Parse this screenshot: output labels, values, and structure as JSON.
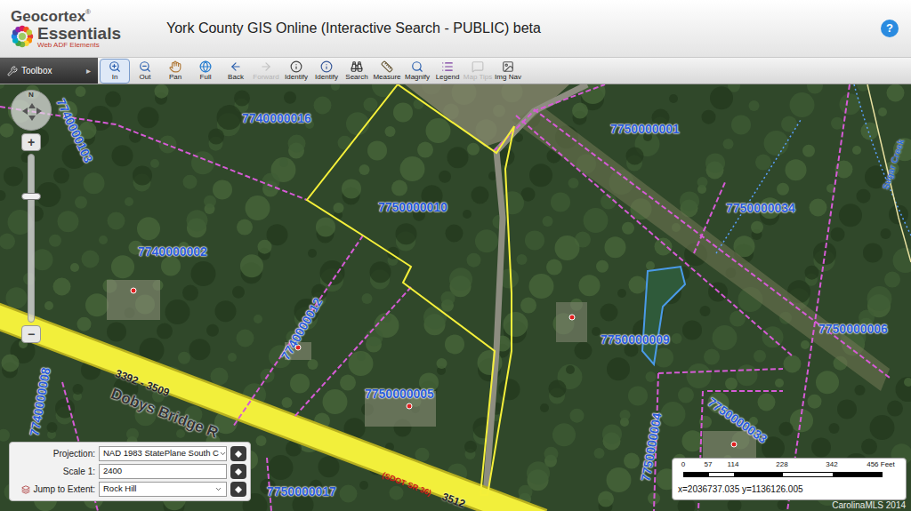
{
  "header": {
    "logo_name": "Geocortex",
    "logo_mark": "®",
    "logo_product": "Essentials",
    "logo_tagline": "Web ADF Elements",
    "title": "York County GIS Online (Interactive Search - PUBLIC) beta",
    "help": "?"
  },
  "toolbar": {
    "toolbox": "Toolbox",
    "toolbox_arrow": "▸",
    "tools": [
      {
        "label": "In",
        "selected": true,
        "disabled": false
      },
      {
        "label": "Out",
        "selected": false,
        "disabled": false
      },
      {
        "label": "Pan",
        "selected": false,
        "disabled": false
      },
      {
        "label": "Full",
        "selected": false,
        "disabled": false
      },
      {
        "label": "Back",
        "selected": false,
        "disabled": false
      },
      {
        "label": "Forward",
        "selected": false,
        "disabled": true
      },
      {
        "label": "Identify",
        "selected": false,
        "disabled": false
      },
      {
        "label": "Identify",
        "selected": false,
        "disabled": false
      },
      {
        "label": "Search",
        "selected": false,
        "disabled": false
      },
      {
        "label": "Measure",
        "selected": false,
        "disabled": false
      },
      {
        "label": "Magnify",
        "selected": false,
        "disabled": false
      },
      {
        "label": "Legend",
        "selected": false,
        "disabled": false
      },
      {
        "label": "Map Tips",
        "selected": false,
        "disabled": true
      },
      {
        "label": "Img Nav",
        "selected": false,
        "disabled": false
      }
    ]
  },
  "zoom": {
    "north": "N",
    "plus": "+",
    "minus": "−",
    "level": 0.76
  },
  "parcels": [
    {
      "label": "7740000016",
      "selected": false
    },
    {
      "label": "7750000010",
      "selected": true
    },
    {
      "label": "7750000001",
      "selected": false
    },
    {
      "label": "7750000034",
      "selected": false
    },
    {
      "label": "7740000002",
      "selected": false
    },
    {
      "label": "7740000012",
      "selected": false
    },
    {
      "label": "7750000005",
      "selected": false
    },
    {
      "label": "7750000009",
      "selected": false
    },
    {
      "label": "7750000006",
      "selected": false
    },
    {
      "label": "7750000004",
      "selected": false
    },
    {
      "label": "7750000033",
      "selected": false
    },
    {
      "label": "7750000017",
      "selected": false
    },
    {
      "label": "7740000008",
      "selected": false
    },
    {
      "label": "7740000103",
      "selected": false
    }
  ],
  "road_labels": [
    {
      "label": "3392 - 3509",
      "kind": "range"
    },
    {
      "label": "Dobys Bridge R",
      "kind": "name"
    },
    {
      "label": "(SDOT SR 36)",
      "kind": "route"
    },
    {
      "label": "3512",
      "kind": "number"
    }
  ],
  "water_labels": [
    "Sugar Creek"
  ],
  "controls": {
    "projection_label": "Projection:",
    "projection": "NAD 1983 StatePlane South C",
    "scale_label": "Scale 1:",
    "scale": "2400",
    "extent_label": "Jump to Extent:",
    "extent": "Rock Hill"
  },
  "scale_bar": {
    "ticks": [
      "0",
      "57",
      "114",
      "228",
      "342",
      "456 Feet"
    ],
    "coords": "x=2036737.035 y=1136126.005"
  },
  "watermark": "CarolinaMLS 2014"
}
